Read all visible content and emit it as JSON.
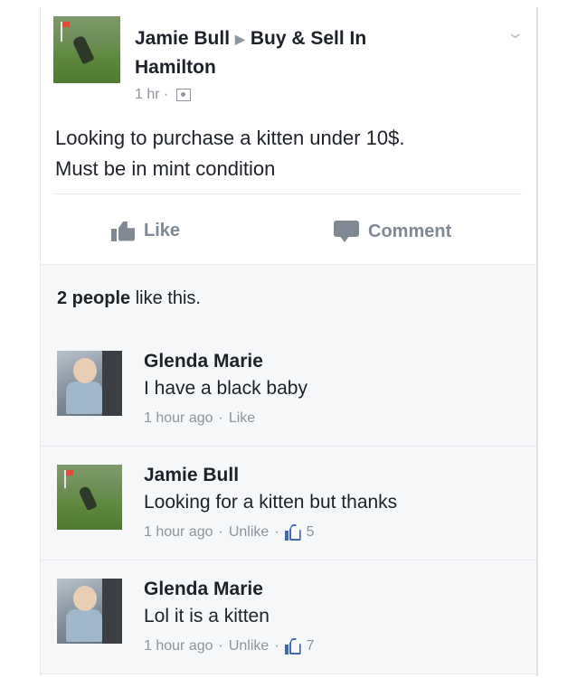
{
  "post": {
    "author": "Jamie Bull",
    "group": "Buy & Sell In",
    "group_line2": "Hamilton",
    "time": "1 hr",
    "dot": "·",
    "text_line1": "Looking to purchase a kitten under 10$.",
    "text_line2": "Must be in mint condition",
    "icons": {
      "privacy": "group-privacy-icon",
      "options": "chevron-down-icon",
      "arrow": "right-triangle-icon"
    }
  },
  "actions": {
    "like_label": "Like",
    "comment_label": "Comment"
  },
  "likes_summary": {
    "count_text": "2 people",
    "suffix": " like this."
  },
  "comments": [
    {
      "author": "Glenda Marie",
      "text": "I have a black baby",
      "time": "1 hour ago",
      "action": "Like",
      "likes": ""
    },
    {
      "author": "Jamie Bull",
      "text": "Looking for a kitten but thanks",
      "time": "1 hour ago",
      "action": "Unlike",
      "likes": "5"
    },
    {
      "author": "Glenda Marie",
      "text": "Lol it is a kitten",
      "time": "1 hour ago",
      "action": "Unlike",
      "likes": "7"
    }
  ],
  "colors": {
    "text": "#1d2129",
    "meta": "#8d949e",
    "action": "#7f8893",
    "link_blue": "#4267b2",
    "comment_bg": "#f6f7f9"
  }
}
